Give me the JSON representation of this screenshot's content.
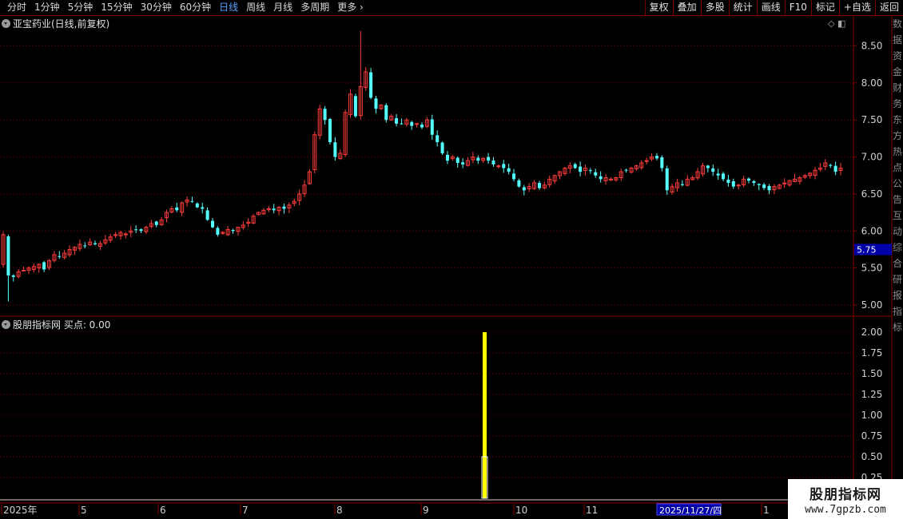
{
  "toolbar": {
    "periods": [
      "分时",
      "1分钟",
      "5分钟",
      "15分钟",
      "30分钟",
      "60分钟",
      "日线",
      "周线",
      "月线",
      "多周期",
      "更多"
    ],
    "active_index": 6,
    "more_arrow": "›",
    "actions": [
      "复权",
      "叠加",
      "多股",
      "统计",
      "画线",
      "F10",
      "标记",
      "+自选",
      "返回"
    ]
  },
  "main_title": "亚宝药业(日线,前复权)",
  "top_icons": "◇ ◧",
  "indicator_title": "股朋指标网 买点: 0.00",
  "price_axis": [
    "8.50",
    "8.00",
    "7.50",
    "7.00",
    "6.50",
    "6.00",
    "5.50",
    "5.00"
  ],
  "price_marker": "5.75",
  "indicator_axis": [
    "2.00",
    "1.75",
    "1.50",
    "1.25",
    "1.00",
    "0.75",
    "0.50",
    "0.25"
  ],
  "time_axis": [
    "2025年",
    "5",
    "6",
    "7",
    "8",
    "9",
    "10",
    "11",
    "1"
  ],
  "cursor_date": "2025/11/27/四",
  "right_panel_chars": "数据资金财务东方热点公告互动综合研报指标",
  "watermark": {
    "title": "股朋指标网",
    "url": "www.7gpzb.com"
  },
  "colors": {
    "up": "#ff3c3c",
    "down": "#54ffff",
    "grid": "#8a0000",
    "signal": "#ffff00",
    "active_tab": "#5aa0ff"
  },
  "chart_data": {
    "type": "candlestick",
    "title": "亚宝药业(日线,前复权)",
    "ylim": [
      4.9,
      8.8
    ],
    "close_series": [
      5.95,
      5.4,
      5.38,
      5.45,
      5.47,
      5.5,
      5.52,
      5.55,
      5.48,
      5.6,
      5.68,
      5.66,
      5.7,
      5.75,
      5.78,
      5.82,
      5.8,
      5.85,
      5.82,
      5.83,
      5.88,
      5.92,
      5.95,
      5.98,
      5.96,
      6.0,
      6.02,
      6.0,
      6.05,
      6.1,
      6.08,
      6.15,
      6.25,
      6.3,
      6.28,
      6.38,
      6.42,
      6.4,
      6.32,
      6.3,
      6.15,
      6.05,
      5.95,
      5.98,
      6.02,
      6.0,
      6.05,
      6.08,
      6.12,
      6.2,
      6.25,
      6.28,
      6.3,
      6.28,
      6.32,
      6.3,
      6.35,
      6.4,
      6.5,
      6.62,
      6.8,
      7.3,
      7.65,
      7.5,
      7.2,
      7.0,
      7.05,
      7.6,
      7.85,
      7.55,
      7.95,
      8.15,
      7.8,
      7.65,
      7.7,
      7.5,
      7.55,
      7.45,
      7.45,
      7.5,
      7.42,
      7.45,
      7.4,
      7.5,
      7.3,
      7.2,
      7.05,
      6.95,
      7.0,
      6.92,
      6.9,
      6.95,
      7.0,
      6.95,
      6.98,
      6.95,
      6.9,
      6.88,
      6.85,
      6.8,
      6.7,
      6.6,
      6.55,
      6.6,
      6.65,
      6.58,
      6.62,
      6.7,
      6.75,
      6.8,
      6.85,
      6.88,
      6.85,
      6.8,
      6.85,
      6.82,
      6.75,
      6.7,
      6.72,
      6.7,
      6.72,
      6.8,
      6.82,
      6.85,
      6.88,
      6.92,
      6.95,
      7.0,
      6.98,
      6.85,
      6.55,
      6.6,
      6.65,
      6.62,
      6.7,
      6.72,
      6.8,
      6.88,
      6.85,
      6.8,
      6.75,
      6.7,
      6.65,
      6.6,
      6.62,
      6.7,
      6.68,
      6.65,
      6.62,
      6.58,
      6.55,
      6.6,
      6.62,
      6.65,
      6.68,
      6.7,
      6.72,
      6.75,
      6.78,
      6.82,
      6.85,
      6.92,
      6.88,
      6.8,
      6.85
    ]
  },
  "indicator_data": {
    "name": "买点",
    "spike_value": 2.0,
    "secondary_value": 0.5,
    "ylim": [
      0,
      2.15
    ]
  }
}
